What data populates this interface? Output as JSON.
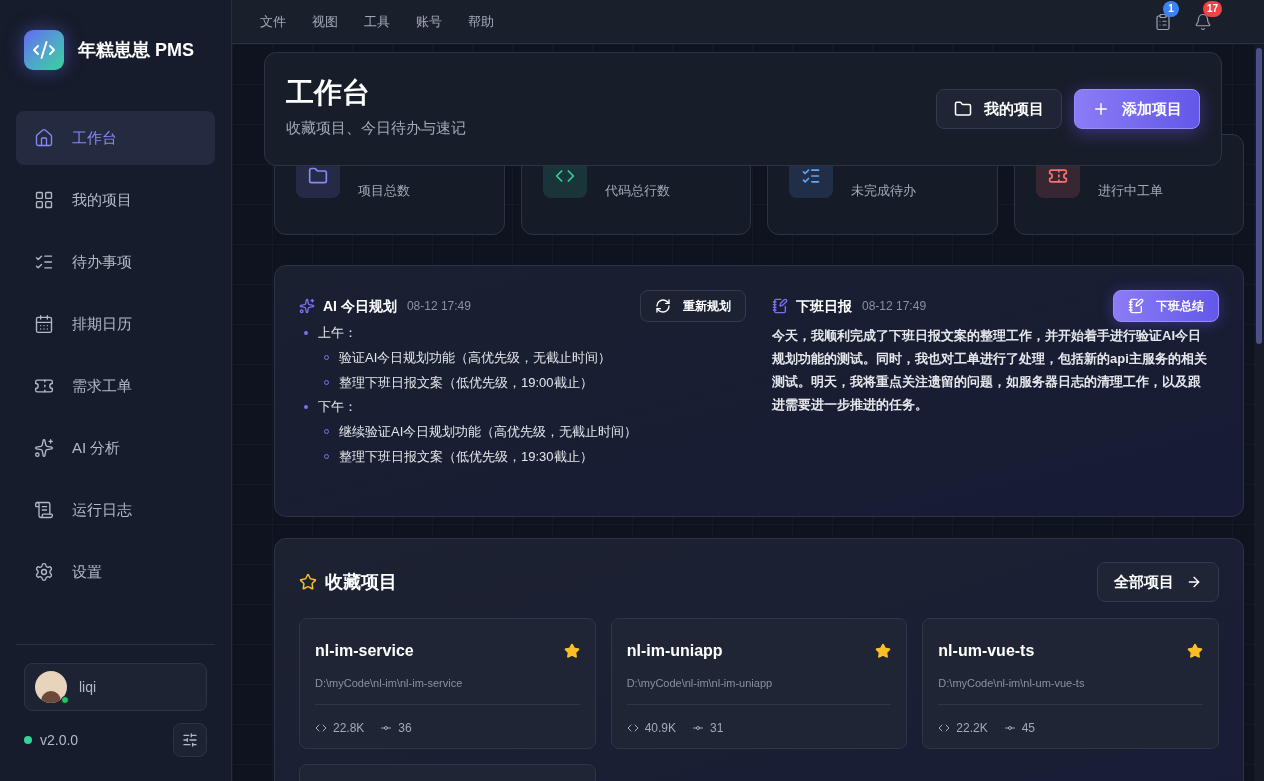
{
  "app": {
    "name": "年糕崽崽 PMS"
  },
  "menu": [
    "文件",
    "视图",
    "工具",
    "账号",
    "帮助"
  ],
  "notifications": [
    {
      "kind": "clipboard",
      "count": "1",
      "color": "#3b82f6"
    },
    {
      "kind": "bell",
      "count": "17",
      "color": "#ef4444"
    }
  ],
  "sidebar": {
    "items": [
      {
        "label": "工作台",
        "kind": "home",
        "selected": true
      },
      {
        "label": "我的项目",
        "kind": "grid",
        "selected": false
      },
      {
        "label": "待办事项",
        "kind": "list",
        "selected": false
      },
      {
        "label": "排期日历",
        "kind": "calendar",
        "selected": false
      },
      {
        "label": "需求工单",
        "kind": "ticket",
        "selected": false
      },
      {
        "label": "AI 分析",
        "kind": "sparkles",
        "selected": false
      },
      {
        "label": "运行日志",
        "kind": "scroll",
        "selected": false
      },
      {
        "label": "设置",
        "kind": "settings",
        "selected": false
      }
    ],
    "user": {
      "name": "liqi",
      "online": true
    },
    "version": "v2.0.0"
  },
  "header": {
    "title": "工作台",
    "subtitle": "收藏项目、今日待办与速记",
    "buttons": [
      {
        "label": "我的项目",
        "kind": "secondary"
      },
      {
        "label": "添加项目",
        "kind": "primary"
      }
    ]
  },
  "stats": [
    {
      "label": "项目总数",
      "kind": "folder",
      "color": "#818cf8"
    },
    {
      "label": "代码总行数",
      "kind": "code",
      "color": "#34d399"
    },
    {
      "label": "未完成待办",
      "kind": "todo",
      "color": "#60a5fa"
    },
    {
      "label": "进行中工单",
      "kind": "ticket",
      "color": "#f87171"
    }
  ],
  "ai_plan": {
    "title": "AI 今日规划",
    "time": "08-12 17:49",
    "button": "重新规划",
    "sections": [
      {
        "label": "上午：",
        "items": [
          "验证AI今日规划功能（高优先级，无截止时间）",
          "整理下班日报文案（低优先级，19:00截止）"
        ]
      },
      {
        "label": "下午：",
        "items": [
          "继续验证AI今日规划功能（高优先级，无截止时间）",
          "整理下班日报文案（低优先级，19:30截止）"
        ]
      }
    ]
  },
  "daily_report": {
    "title": "下班日报",
    "time": "08-12 17:49",
    "button": "下班总结",
    "text": "今天，我顺利完成了下班日报文案的整理工作，并开始着手进行验证AI今日规划功能的测试。同时，我也对工单进行了处理，包括新的api主服务的相关测试。明天，我将重点关注遗留的问题，如服务器日志的清理工作，以及跟进需要进一步推进的任务。"
  },
  "favorites": {
    "title": "收藏项目",
    "button": "全部项目",
    "projects": [
      {
        "name": "nl-im-service",
        "path": "D:\\myCode\\nl-im\\nl-im-service",
        "lines": "22.8K",
        "commits": "36",
        "starred": true
      },
      {
        "name": "nl-im-uniapp",
        "path": "D:\\myCode\\nl-im\\nl-im-uniapp",
        "lines": "40.9K",
        "commits": "31",
        "starred": true
      },
      {
        "name": "nl-um-vue-ts",
        "path": "D:\\myCode\\nl-im\\nl-um-vue-ts",
        "lines": "22.2K",
        "commits": "45",
        "starred": true
      }
    ]
  }
}
